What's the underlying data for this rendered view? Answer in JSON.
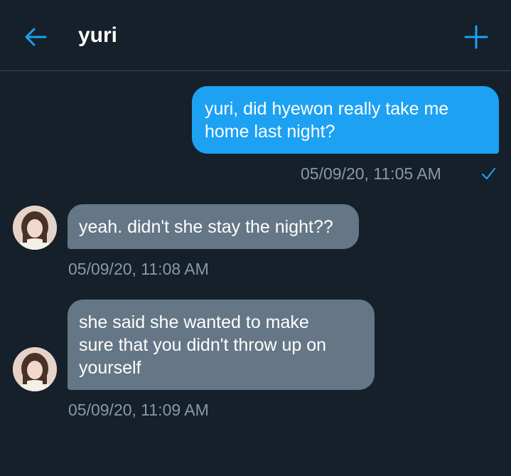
{
  "header": {
    "contact_name": "yuri",
    "back_icon": "arrow-left-icon",
    "add_icon": "plus-icon",
    "accent_color": "#1da1f2"
  },
  "messages": [
    {
      "direction": "sent",
      "text": "yuri, did hyewon really take me\nhome last night?",
      "timestamp": "05/09/20, 11:05 AM",
      "status_icon": "checkmark-icon"
    },
    {
      "direction": "received",
      "text": "yeah. didn't she stay the night??",
      "timestamp": "05/09/20, 11:08 AM"
    },
    {
      "direction": "received",
      "text": "she said she wanted to make\nsure that you didn't throw up on\nyourself",
      "timestamp": "05/09/20, 11:09 AM"
    }
  ],
  "colors": {
    "background": "#15202b",
    "sent_bubble": "#1da1f2",
    "received_bubble": "#657786",
    "timestamp": "#8899a6",
    "divider": "#38444d"
  }
}
